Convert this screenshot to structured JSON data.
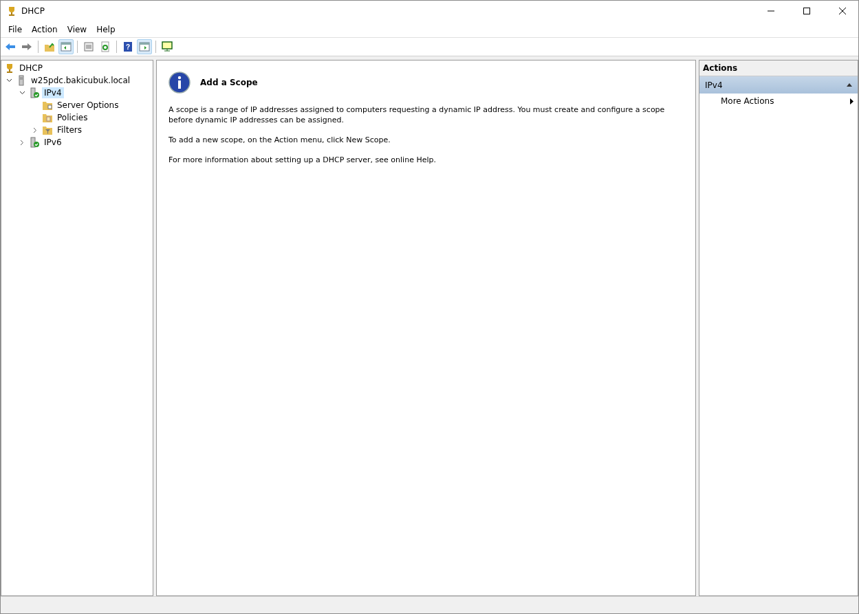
{
  "window": {
    "title": "DHCP"
  },
  "menu": [
    {
      "label": "File"
    },
    {
      "label": "Action"
    },
    {
      "label": "View"
    },
    {
      "label": "Help"
    }
  ],
  "toolbar": [
    {
      "kind": "back",
      "pressed": false
    },
    {
      "kind": "forward",
      "pressed": false
    },
    {
      "kind": "separator"
    },
    {
      "kind": "up",
      "pressed": false
    },
    {
      "kind": "tree-toggle",
      "pressed": true
    },
    {
      "kind": "separator"
    },
    {
      "kind": "properties",
      "pressed": false
    },
    {
      "kind": "refresh",
      "pressed": false
    },
    {
      "kind": "separator"
    },
    {
      "kind": "help",
      "pressed": false,
      "glyph": "?"
    },
    {
      "kind": "action-toggle",
      "pressed": true
    },
    {
      "kind": "separator"
    },
    {
      "kind": "monitor",
      "pressed": false
    }
  ],
  "tree": [
    {
      "label": "DHCP",
      "kind": "root",
      "selected": false,
      "children": [
        {
          "label": "w25pdc.bakicubuk.local",
          "kind": "server",
          "selected": false,
          "expanded": true,
          "children": [
            {
              "label": "IPv4",
              "kind": "protocol",
              "selected": true,
              "expanded": true,
              "children": [
                {
                  "label": "Server Options",
                  "kind": "options",
                  "selected": false
                },
                {
                  "label": "Policies",
                  "kind": "policies",
                  "selected": false
                },
                {
                  "label": "Filters",
                  "kind": "filters",
                  "selected": false,
                  "expanded": false
                }
              ]
            },
            {
              "label": "IPv6",
              "kind": "protocol",
              "selected": false,
              "expanded": false
            }
          ]
        }
      ]
    }
  ],
  "content": {
    "title": "Add a Scope",
    "paragraphs": [
      "A scope is a range of IP addresses assigned to computers requesting a dynamic IP address. You must create and configure a scope before dynamic IP addresses can be assigned.",
      "To add a new scope, on the Action menu, click New Scope.",
      "For more information about setting up a DHCP server, see online Help."
    ]
  },
  "actions": {
    "header": "Actions",
    "sections": [
      {
        "title": "IPv4",
        "expanded": true,
        "items": [
          {
            "label": "More Actions"
          }
        ]
      }
    ]
  }
}
